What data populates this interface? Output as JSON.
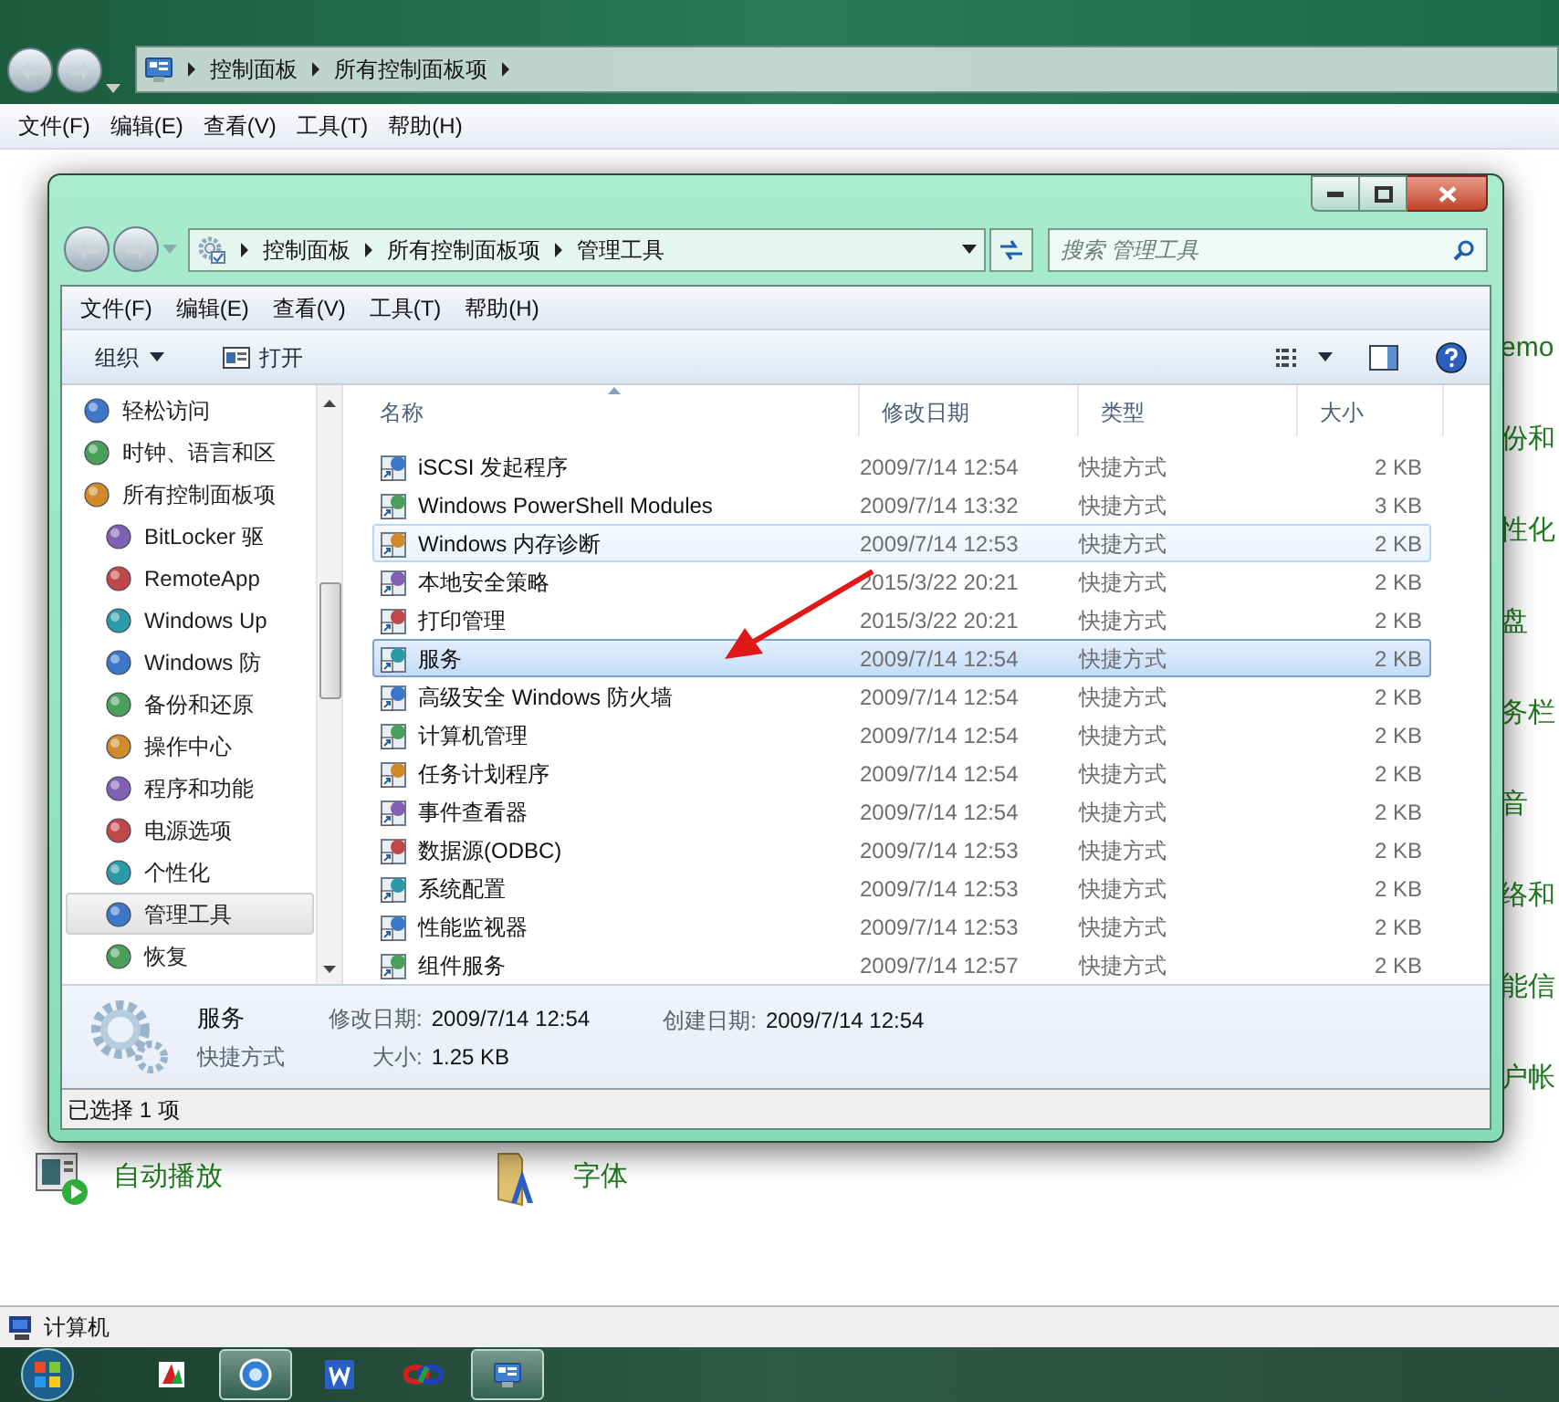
{
  "background_window": {
    "address_path": [
      "控制面板",
      "所有控制面板项"
    ],
    "menu": [
      "文件(F)",
      "编辑(E)",
      "查看(V)",
      "工具(T)",
      "帮助(H)"
    ],
    "partial_items": [
      "emo",
      "份和",
      "性化",
      "盘",
      "务栏",
      "音",
      "络和",
      "能信",
      "户帐"
    ],
    "items": [
      {
        "label": "自动播放",
        "kind": "autoplay"
      },
      {
        "label": "字体",
        "kind": "fonts"
      }
    ],
    "status_bar": "计算机"
  },
  "window": {
    "address_path": [
      "控制面板",
      "所有控制面板项",
      "管理工具"
    ],
    "search": {
      "placeholder": "搜索 管理工具"
    },
    "menu": [
      "文件(F)",
      "编辑(E)",
      "查看(V)",
      "工具(T)",
      "帮助(H)"
    ],
    "toolbar": {
      "organize": "组织",
      "open": "打开"
    },
    "nav_tree": [
      {
        "label": "轻松访问",
        "selected": false
      },
      {
        "label": "时钟、语言和区",
        "selected": false
      },
      {
        "label": "所有控制面板项",
        "selected": false,
        "children": [
          {
            "label": "BitLocker 驱",
            "selected": false
          },
          {
            "label": "RemoteApp",
            "selected": false
          },
          {
            "label": "Windows Up",
            "selected": false
          },
          {
            "label": "Windows 防",
            "selected": false
          },
          {
            "label": "备份和还原",
            "selected": false
          },
          {
            "label": "操作中心",
            "selected": false
          },
          {
            "label": "程序和功能",
            "selected": false
          },
          {
            "label": "电源选项",
            "selected": false
          },
          {
            "label": "个性化",
            "selected": false
          },
          {
            "label": "管理工具",
            "selected": true
          },
          {
            "label": "恢复",
            "selected": false
          }
        ]
      }
    ],
    "columns": [
      {
        "label": "名称",
        "sorted": true
      },
      {
        "label": "修改日期",
        "sorted": false
      },
      {
        "label": "类型",
        "sorted": false
      },
      {
        "label": "大小",
        "sorted": false
      }
    ],
    "rows": [
      {
        "name": "iSCSI 发起程序",
        "date": "2009/7/14 12:54",
        "type": "快捷方式",
        "size": "2 KB",
        "selected": false,
        "hot": false
      },
      {
        "name": "Windows PowerShell Modules",
        "date": "2009/7/14 13:32",
        "type": "快捷方式",
        "size": "3 KB",
        "selected": false,
        "hot": false
      },
      {
        "name": "Windows 内存诊断",
        "date": "2009/7/14 12:53",
        "type": "快捷方式",
        "size": "2 KB",
        "selected": false,
        "hot": true
      },
      {
        "name": "本地安全策略",
        "date": "2015/3/22 20:21",
        "type": "快捷方式",
        "size": "2 KB",
        "selected": false,
        "hot": false
      },
      {
        "name": "打印管理",
        "date": "2015/3/22 20:21",
        "type": "快捷方式",
        "size": "2 KB",
        "selected": false,
        "hot": false
      },
      {
        "name": "服务",
        "date": "2009/7/14 12:54",
        "type": "快捷方式",
        "size": "2 KB",
        "selected": true,
        "hot": false
      },
      {
        "name": "高级安全 Windows 防火墙",
        "date": "2009/7/14 12:54",
        "type": "快捷方式",
        "size": "2 KB",
        "selected": false,
        "hot": false
      },
      {
        "name": "计算机管理",
        "date": "2009/7/14 12:54",
        "type": "快捷方式",
        "size": "2 KB",
        "selected": false,
        "hot": false
      },
      {
        "name": "任务计划程序",
        "date": "2009/7/14 12:54",
        "type": "快捷方式",
        "size": "2 KB",
        "selected": false,
        "hot": false
      },
      {
        "name": "事件查看器",
        "date": "2009/7/14 12:54",
        "type": "快捷方式",
        "size": "2 KB",
        "selected": false,
        "hot": false
      },
      {
        "name": "数据源(ODBC)",
        "date": "2009/7/14 12:53",
        "type": "快捷方式",
        "size": "2 KB",
        "selected": false,
        "hot": false
      },
      {
        "name": "系统配置",
        "date": "2009/7/14 12:53",
        "type": "快捷方式",
        "size": "2 KB",
        "selected": false,
        "hot": false
      },
      {
        "name": "性能监视器",
        "date": "2009/7/14 12:53",
        "type": "快捷方式",
        "size": "2 KB",
        "selected": false,
        "hot": false
      },
      {
        "name": "组件服务",
        "date": "2009/7/14 12:57",
        "type": "快捷方式",
        "size": "2 KB",
        "selected": false,
        "hot": false
      }
    ],
    "details": {
      "name": "服务",
      "type": "快捷方式",
      "modified_label": "修改日期:",
      "modified": "2009/7/14 12:54",
      "created_label": "创建日期:",
      "created": "2009/7/14 12:54",
      "size_label": "大小:",
      "size": "1.25 KB"
    },
    "status_bar": "已选择 1 项"
  },
  "taskbar": {
    "buttons": [
      {
        "kind": "red-app",
        "active": false
      },
      {
        "kind": "browser",
        "active": true
      },
      {
        "kind": "wps",
        "active": false
      },
      {
        "kind": "colorful",
        "active": false
      },
      {
        "kind": "control-panel",
        "active": true
      }
    ]
  }
}
